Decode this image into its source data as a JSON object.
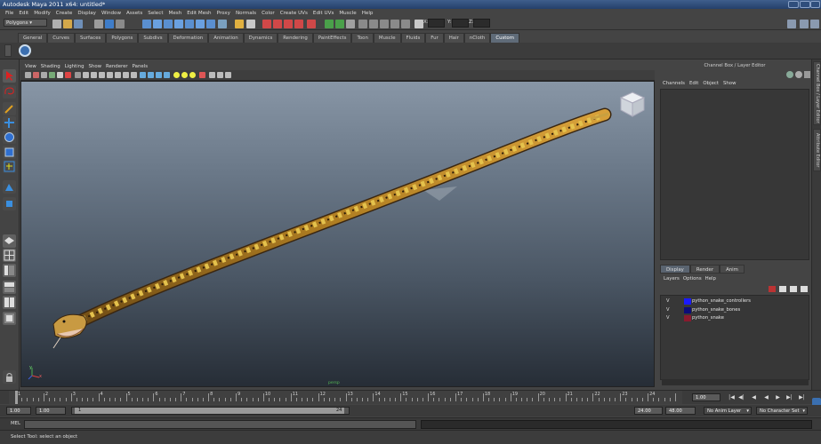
{
  "window": {
    "title": "Autodesk Maya 2011 x64: untitled*"
  },
  "menubar": [
    "File",
    "Edit",
    "Modify",
    "Create",
    "Display",
    "Window",
    "Assets",
    "Select",
    "Mesh",
    "Edit Mesh",
    "Proxy",
    "Normals",
    "Color",
    "Create UVs",
    "Edit UVs",
    "Muscle",
    "Help"
  ],
  "statusline": {
    "mode": "Polygons",
    "x_label": "X:",
    "y_label": "Y:",
    "z_label": "Z:"
  },
  "shelf": {
    "tabs": [
      "General",
      "Curves",
      "Surfaces",
      "Polygons",
      "Subdivs",
      "Deformation",
      "Animation",
      "Dynamics",
      "Rendering",
      "PaintEffects",
      "Toon",
      "Muscle",
      "Fluids",
      "Fur",
      "Hair",
      "nCloth",
      "Custom"
    ],
    "active_tab": "Custom"
  },
  "viewport": {
    "menu": [
      "View",
      "Shading",
      "Lighting",
      "Show",
      "Renderer",
      "Panels"
    ],
    "camera_label": "persp",
    "axis_y": "y",
    "axis_x": "x"
  },
  "channelbox": {
    "title": "Channel Box / Layer Editor",
    "menu": [
      "Channels",
      "Edit",
      "Object",
      "Show"
    ]
  },
  "layereditor": {
    "tabs": [
      "Display",
      "Render",
      "Anim"
    ],
    "active_tab": "Display",
    "menu": [
      "Layers",
      "Options",
      "Help"
    ],
    "layers": [
      {
        "vis": "V",
        "name": "python_snake_controllers",
        "color": "#1a1aff"
      },
      {
        "vis": "V",
        "name": "python_snake_bones",
        "color": "#0c0c78"
      },
      {
        "vis": "V",
        "name": "python_snake",
        "color": "#8a1a2e"
      }
    ]
  },
  "sidetabs": [
    "Channel Box / Layer Editor",
    "Attribute Editor"
  ],
  "timeslider": {
    "ticks": [
      "1",
      "2",
      "3",
      "4",
      "5",
      "6",
      "7",
      "8",
      "9",
      "10",
      "11",
      "12",
      "13",
      "14",
      "15",
      "16",
      "17",
      "18",
      "19",
      "20",
      "21",
      "22",
      "23",
      "24"
    ],
    "current_frame": "1.00"
  },
  "rangeslider": {
    "start": "1.00",
    "playback_start": "1.00",
    "range_start_label": "1",
    "range_end_label": "24",
    "playback_end": "24.00",
    "end": "48.00",
    "anim_layer": "No Anim Layer",
    "char_set": "No Character Set"
  },
  "cmdline": {
    "label": "MEL"
  },
  "helpline": {
    "text": "Select Tool: select an object"
  }
}
